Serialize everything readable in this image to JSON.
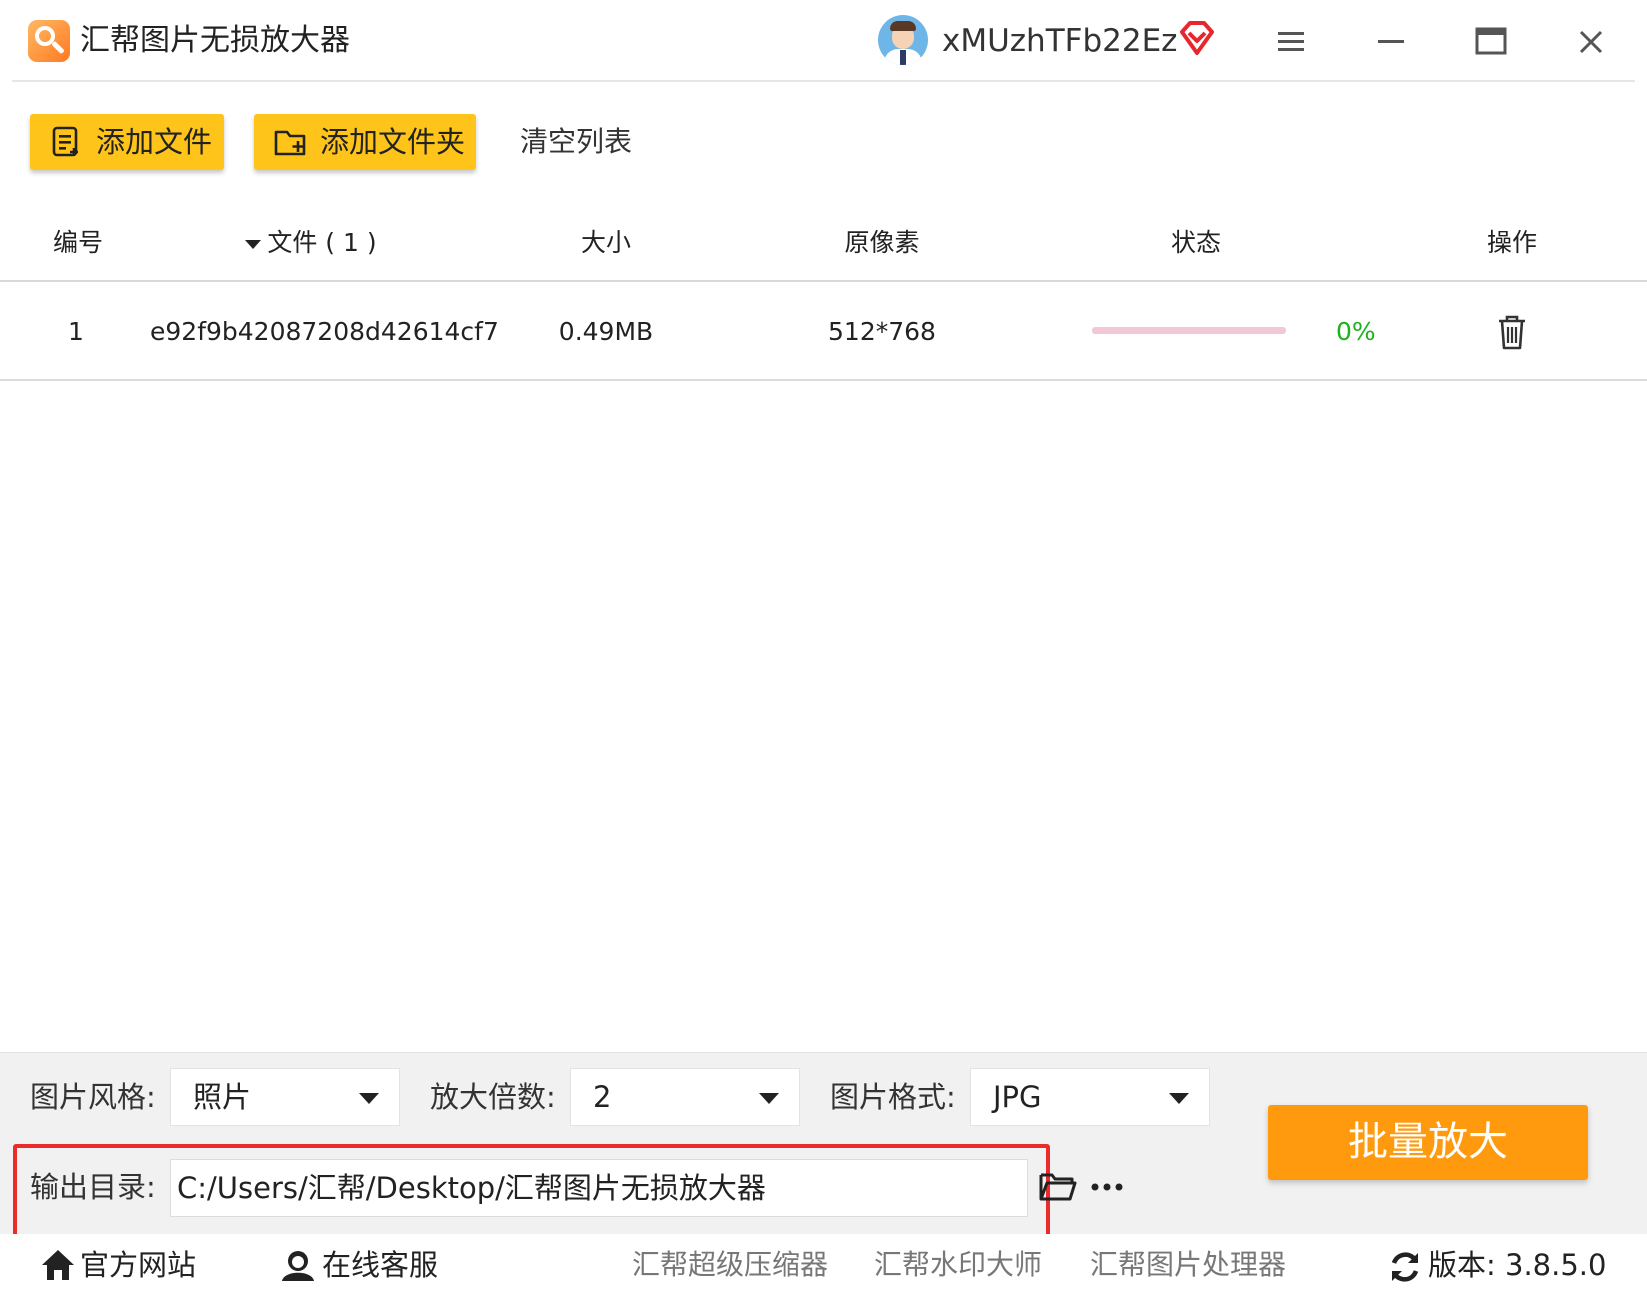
{
  "window": {
    "title": "汇帮图片无损放大器",
    "username": "xMUzhTFb22Ez"
  },
  "toolbar": {
    "add_file": "添加文件",
    "add_folder": "添加文件夹",
    "clear_list": "清空列表"
  },
  "table": {
    "columns": [
      "编号",
      "文件 ( 1 )",
      "大小",
      "原像素",
      "状态",
      "操作"
    ],
    "rows": [
      {
        "index": "1",
        "filename": "e92f9b42087208d42614cf7",
        "size": "0.49MB",
        "pixels": "512*768",
        "progress_fraction": 0.0,
        "percent": "0%"
      }
    ]
  },
  "settings": {
    "style_label": "图片风格:",
    "style_value": "照片",
    "scale_label": "放大倍数:",
    "scale_value": "2",
    "format_label": "图片格式:",
    "format_value": "JPG",
    "output_label": "输出目录:",
    "output_path": "C:/Users/汇帮/Desktop/汇帮图片无损放大器",
    "batch_button": "批量放大"
  },
  "footer": {
    "website": "官方网站",
    "support": "在线客服",
    "link_compressor": "汇帮超级压缩器",
    "link_watermark": "汇帮水印大师",
    "link_processor": "汇帮图片处理器",
    "version": "版本: 3.8.5.0"
  },
  "colors": {
    "accent_yellow": "#ffc41a",
    "batch_orange": "#ff9a0e",
    "highlight_red": "#ec2b2b",
    "progress_pink": "#f4c7d6",
    "percent_green": "#1db21d"
  },
  "icons": [
    "app-logo-icon",
    "user-avatar-icon",
    "vip-diamond-icon",
    "menu-icon",
    "minimize-icon",
    "maximize-icon",
    "close-icon",
    "file-list-icon",
    "folder-add-icon",
    "sort-down-icon",
    "trash-icon",
    "folder-open-icon",
    "more-icon",
    "home-icon",
    "support-icon",
    "refresh-icon"
  ]
}
